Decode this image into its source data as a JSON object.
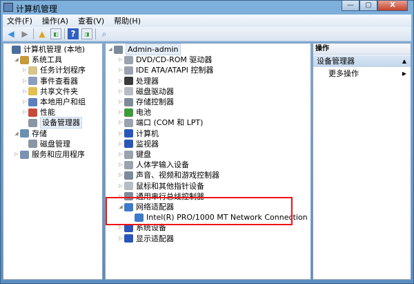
{
  "window": {
    "title": "计算机管理",
    "minimize": "—",
    "maximize": "▢",
    "close": "X"
  },
  "menu": [
    "文件(F)",
    "操作(A)",
    "查看(V)",
    "帮助(H)"
  ],
  "left_tree": [
    {
      "label": "计算机管理 (本地)",
      "level": 0,
      "arrow": "",
      "icon": "computer-management-icon",
      "color": "#4a6f9c"
    },
    {
      "label": "系统工具",
      "level": 1,
      "arrow": "◢",
      "icon": "tools-icon",
      "color": "#c79a3a"
    },
    {
      "label": "任务计划程序",
      "level": 2,
      "arrow": "▷",
      "icon": "clock-icon",
      "color": "#d9c48a"
    },
    {
      "label": "事件查看器",
      "level": 2,
      "arrow": "▷",
      "icon": "event-viewer-icon",
      "color": "#8a9cc0"
    },
    {
      "label": "共享文件夹",
      "level": 2,
      "arrow": "▷",
      "icon": "shared-folder-icon",
      "color": "#e1c050"
    },
    {
      "label": "本地用户和组",
      "level": 2,
      "arrow": "▷",
      "icon": "users-icon",
      "color": "#5a80c0"
    },
    {
      "label": "性能",
      "level": 2,
      "arrow": "▷",
      "icon": "performance-icon",
      "color": "#c84a3a"
    },
    {
      "label": "设备管理器",
      "level": 2,
      "arrow": "",
      "icon": "device-manager-icon",
      "color": "#8a96a4",
      "selected": true
    },
    {
      "label": "存储",
      "level": 1,
      "arrow": "◢",
      "icon": "storage-icon",
      "color": "#6b8fb0"
    },
    {
      "label": "磁盘管理",
      "level": 2,
      "arrow": "",
      "icon": "disk-management-icon",
      "color": "#8a96a4"
    },
    {
      "label": "服务和应用程序",
      "level": 1,
      "arrow": "▷",
      "icon": "services-icon",
      "color": "#7a92b4"
    }
  ],
  "device_tree": [
    {
      "label": "Admin-admin",
      "level": 0,
      "arrow": "◢",
      "icon": "computer-icon",
      "color": "#7d8a99",
      "selected": true
    },
    {
      "label": "DVD/CD-ROM 驱动器",
      "level": 1,
      "arrow": "▷",
      "icon": "dvd-icon",
      "color": "#9aa3ad"
    },
    {
      "label": "IDE ATA/ATAPI 控制器",
      "level": 1,
      "arrow": "▷",
      "icon": "ide-icon",
      "color": "#9aa3ad"
    },
    {
      "label": "处理器",
      "level": 1,
      "arrow": "▷",
      "icon": "processor-icon",
      "color": "#3b3b3b"
    },
    {
      "label": "磁盘驱动器",
      "level": 1,
      "arrow": "▷",
      "icon": "disk-drive-icon",
      "color": "#b5bcc4"
    },
    {
      "label": "存储控制器",
      "level": 1,
      "arrow": "▷",
      "icon": "storage-controller-icon",
      "color": "#7d8a99"
    },
    {
      "label": "电池",
      "level": 1,
      "arrow": "▷",
      "icon": "battery-icon",
      "color": "#3f9a3a"
    },
    {
      "label": "端口 (COM 和 LPT)",
      "level": 1,
      "arrow": "▷",
      "icon": "port-icon",
      "color": "#9aa3ad"
    },
    {
      "label": "计算机",
      "level": 1,
      "arrow": "▷",
      "icon": "computer-icon",
      "color": "#2a56b8"
    },
    {
      "label": "监视器",
      "level": 1,
      "arrow": "▷",
      "icon": "monitor-icon",
      "color": "#2a56b8"
    },
    {
      "label": "键盘",
      "level": 1,
      "arrow": "▷",
      "icon": "keyboard-icon",
      "color": "#9aa3ad"
    },
    {
      "label": "人体学输入设备",
      "level": 1,
      "arrow": "▷",
      "icon": "hid-icon",
      "color": "#9aa3ad"
    },
    {
      "label": "声音、视频和游戏控制器",
      "level": 1,
      "arrow": "▷",
      "icon": "sound-icon",
      "color": "#7d8a99"
    },
    {
      "label": "鼠标和其他指针设备",
      "level": 1,
      "arrow": "▷",
      "icon": "mouse-icon",
      "color": "#b5bcc4"
    },
    {
      "label": "通用串行总线控制器",
      "level": 1,
      "arrow": "▷",
      "icon": "usb-icon",
      "color": "#7d8a99"
    },
    {
      "label": "网络适配器",
      "level": 1,
      "arrow": "◢",
      "icon": "network-adapter-icon",
      "color": "#3f7ac8"
    },
    {
      "label": "Intel(R) PRO/1000 MT Network Connection",
      "level": 2,
      "arrow": "",
      "icon": "network-adapter-icon",
      "color": "#3f7ac8"
    },
    {
      "label": "系统设备",
      "level": 1,
      "arrow": "▷",
      "icon": "system-device-icon",
      "color": "#2a56b8"
    },
    {
      "label": "显示适配器",
      "level": 1,
      "arrow": "▷",
      "icon": "display-adapter-icon",
      "color": "#2a56b8"
    }
  ],
  "actions": {
    "header": "操作",
    "section": "设备管理器",
    "section_arrow": "▲",
    "more": "更多操作",
    "more_arrow": "▶"
  },
  "highlight_color": "#e11111"
}
